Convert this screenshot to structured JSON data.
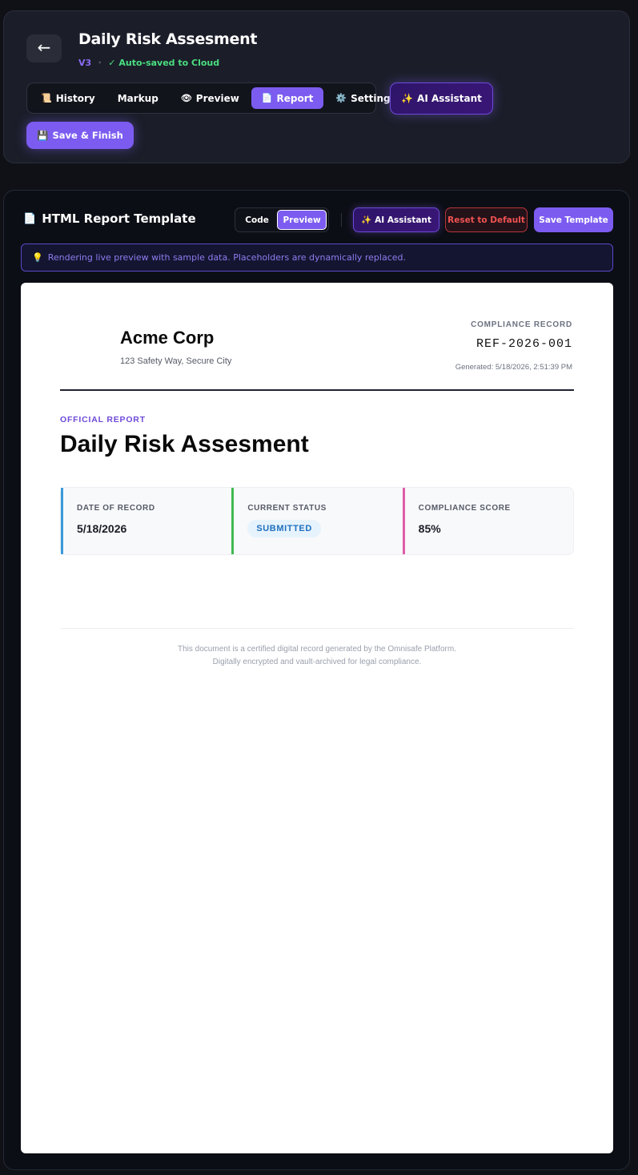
{
  "header": {
    "back_icon": "←",
    "title": "Daily Risk Assesment",
    "version": "V3",
    "separator": "•",
    "autosave": "✓ Auto-saved to Cloud",
    "tabs": [
      {
        "icon": "📜",
        "label": "History",
        "active": false
      },
      {
        "icon": "",
        "label": "Markup",
        "active": false
      },
      {
        "icon": "👁",
        "label": "Preview",
        "active": false
      },
      {
        "icon": "📄",
        "label": "Report",
        "active": true
      },
      {
        "icon": "⚙️",
        "label": "Settings",
        "active": false
      }
    ],
    "ai_assistant": {
      "icon": "✨",
      "label": "AI Assistant"
    },
    "save_finish": {
      "icon": "💾",
      "label": "Save & Finish"
    }
  },
  "editor": {
    "title_icon": "📄",
    "title": "HTML Report Template",
    "mode_code": "Code",
    "mode_preview": "Preview",
    "ai_assistant": {
      "icon": "✨",
      "label": "AI Assistant"
    },
    "reset_label": "Reset to Default",
    "save_label": "Save Template",
    "notice_icon": "💡",
    "notice": "Rendering live preview with sample data. Placeholders are dynamically replaced."
  },
  "report": {
    "company": "Acme Corp",
    "address": "123 Safety Way, Secure City",
    "record_label": "COMPLIANCE RECORD",
    "record_id": "REF-2026-001",
    "generated": "Generated: 5/18/2026, 2:51:39 PM",
    "kicker": "OFFICIAL REPORT",
    "title": "Daily Risk Assesment",
    "cards": [
      {
        "label": "DATE OF RECORD",
        "value": "5/18/2026",
        "color": "#3b9ad9"
      },
      {
        "label": "CURRENT STATUS",
        "value": "SUBMITTED",
        "color": "#3fb950"
      },
      {
        "label": "COMPLIANCE SCORE",
        "value": "85%",
        "color": "#e05ca8"
      }
    ],
    "footer_line1": "This document is a certified digital record generated by the Omnisafe Platform.",
    "footer_line2": "Digitally encrypted and vault-archived for legal compliance."
  },
  "colors": {
    "accent": "#7c5cf0",
    "success": "#4ade80",
    "danger": "#f05252"
  }
}
